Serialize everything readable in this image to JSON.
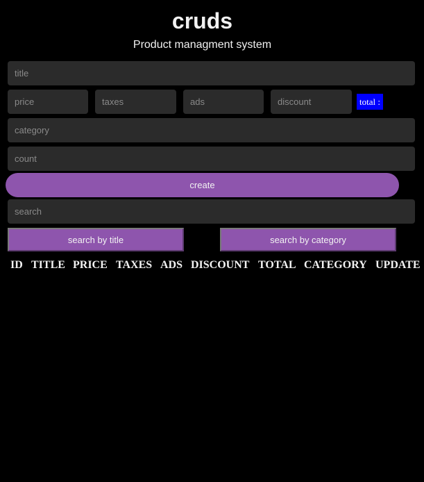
{
  "header": {
    "title": "cruds",
    "subtitle": "Product managment system"
  },
  "form": {
    "title_placeholder": "title",
    "price_placeholder": "price",
    "taxes_placeholder": "taxes",
    "ads_placeholder": "ads",
    "discount_placeholder": "discount",
    "total_label": "total :",
    "category_placeholder": "category",
    "count_placeholder": "count",
    "create_label": "create"
  },
  "search": {
    "placeholder": "search",
    "by_title_label": "search by title",
    "by_category_label": "search by category"
  },
  "table": {
    "columns": [
      "ID",
      "TITLE",
      "PRICE",
      "TAXES",
      "ADS",
      "DISCOUNT",
      "TOTAL",
      "CATEGORY",
      "UPDATE"
    ]
  },
  "colors": {
    "background": "#000000",
    "input_bg": "#2b2b2b",
    "accent_purple": "#8e55ad",
    "total_badge": "#0000ff"
  }
}
